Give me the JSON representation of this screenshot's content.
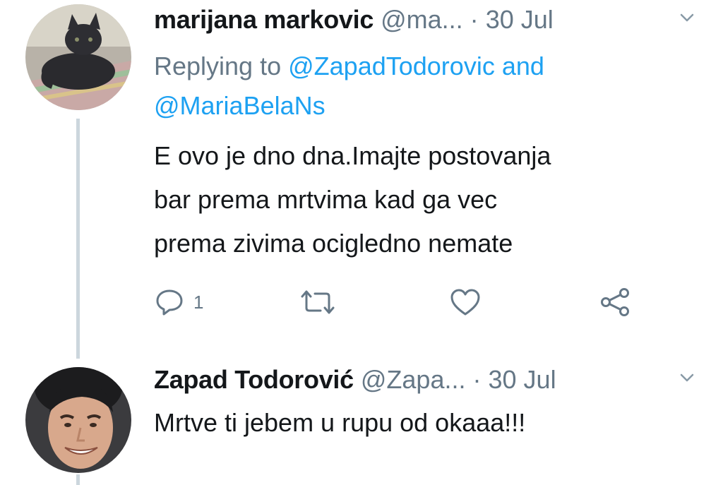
{
  "tweets": [
    {
      "name": "marijana markovic",
      "handle": "@ma...",
      "separator": "·",
      "time": "30 Jul",
      "avatar_icon": "cat-avatar",
      "replying_prefix": "Replying to",
      "reply_to_1": "@ZapadTodorovic",
      "reply_and": "and",
      "reply_to_2": "@MariaBelaNs",
      "text_lines": [
        "E ovo je dno dna.Imajte postovanja",
        "bar prema mrtvima kad ga vec",
        "prema zivima ocigledno nemate"
      ],
      "actions": {
        "reply_icon": "reply-icon",
        "reply_count": "1",
        "retweet_icon": "retweet-icon",
        "like_icon": "heart-icon",
        "share_icon": "share-icon"
      }
    },
    {
      "name": "Zapad Todorović",
      "handle": "@Zapa...",
      "separator": "·",
      "time": "30 Jul",
      "avatar_icon": "person-avatar",
      "text_lines": [
        "Mrtve ti jebem u rupu od okaaa!!!"
      ]
    }
  ],
  "colors": {
    "text": "#14171a",
    "secondary": "#657786",
    "link": "#1da1f2",
    "thread_line": "#ccd6dd",
    "background": "#ffffff"
  }
}
